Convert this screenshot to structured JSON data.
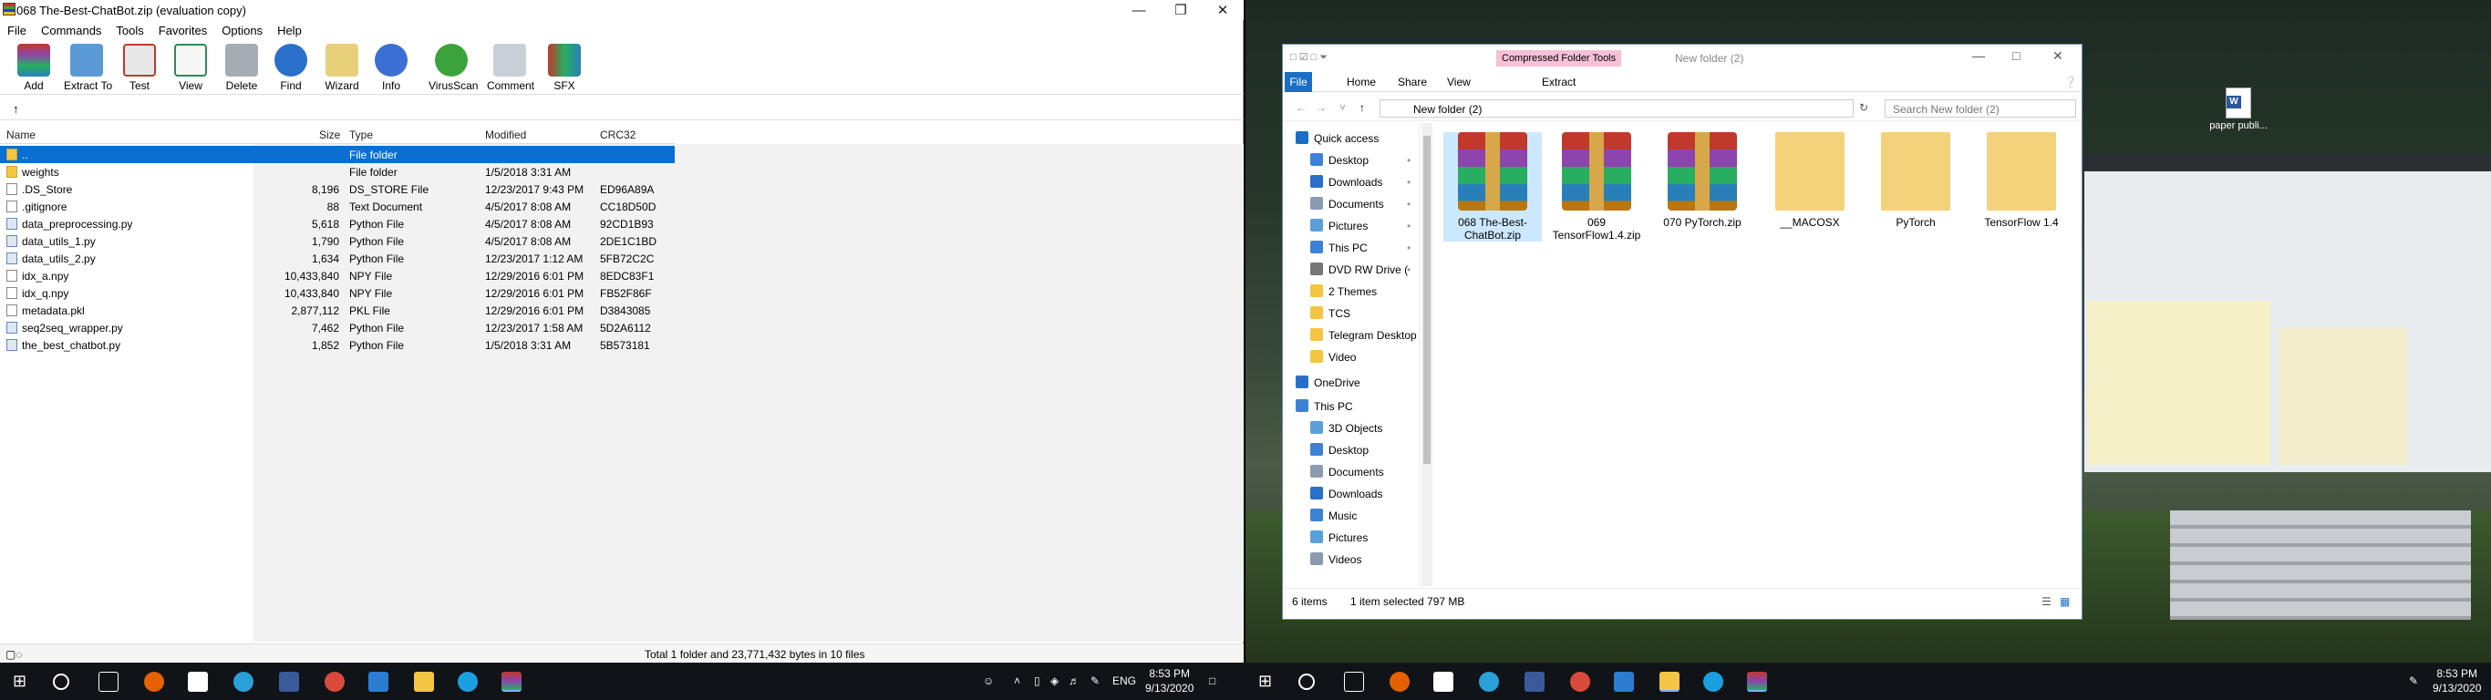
{
  "rar": {
    "title": "068 The-Best-ChatBot.zip (evaluation copy)",
    "menu": [
      "File",
      "Commands",
      "Tools",
      "Favorites",
      "Options",
      "Help"
    ],
    "toolbar": [
      {
        "label": "Add",
        "icon": "add-icon"
      },
      {
        "label": "Extract To",
        "icon": "extract-icon"
      },
      {
        "label": "Test",
        "icon": "test-icon"
      },
      {
        "label": "View",
        "icon": "view-icon"
      },
      {
        "label": "Delete",
        "icon": "delete-icon"
      },
      {
        "label": "Find",
        "icon": "find-icon"
      },
      {
        "label": "Wizard",
        "icon": "wizard-icon"
      },
      {
        "label": "Info",
        "icon": "info-icon"
      },
      {
        "label": "VirusScan",
        "icon": "virusscan-icon"
      },
      {
        "label": "Comment",
        "icon": "comment-icon"
      },
      {
        "label": "SFX",
        "icon": "sfx-icon"
      }
    ],
    "columns": [
      "Name",
      "Size",
      "Type",
      "Modified",
      "CRC32"
    ],
    "files": [
      {
        "name": "..",
        "size": "",
        "type": "File folder",
        "modified": "",
        "crc": "",
        "kind": "folder"
      },
      {
        "name": "weights",
        "size": "",
        "type": "File folder",
        "modified": "1/5/2018 3:31 AM",
        "crc": "",
        "kind": "folder"
      },
      {
        "name": ".DS_Store",
        "size": "8,196",
        "type": "DS_STORE File",
        "modified": "12/23/2017 9:43 PM",
        "crc": "ED96A89A",
        "kind": "file"
      },
      {
        "name": ".gitignore",
        "size": "88",
        "type": "Text Document",
        "modified": "4/5/2017 8:08 AM",
        "crc": "CC18D50D",
        "kind": "file"
      },
      {
        "name": "data_preprocessing.py",
        "size": "5,618",
        "type": "Python File",
        "modified": "4/5/2017 8:08 AM",
        "crc": "92CD1B93",
        "kind": "py"
      },
      {
        "name": "data_utils_1.py",
        "size": "1,790",
        "type": "Python File",
        "modified": "4/5/2017 8:08 AM",
        "crc": "2DE1C1BD",
        "kind": "py"
      },
      {
        "name": "data_utils_2.py",
        "size": "1,634",
        "type": "Python File",
        "modified": "12/23/2017 1:12 AM",
        "crc": "5FB72C2C",
        "kind": "py"
      },
      {
        "name": "idx_a.npy",
        "size": "10,433,840",
        "type": "NPY File",
        "modified": "12/29/2016 6:01 PM",
        "crc": "8EDC83F1",
        "kind": "file"
      },
      {
        "name": "idx_q.npy",
        "size": "10,433,840",
        "type": "NPY File",
        "modified": "12/29/2016 6:01 PM",
        "crc": "FB52F86F",
        "kind": "file"
      },
      {
        "name": "metadata.pkl",
        "size": "2,877,112",
        "type": "PKL File",
        "modified": "12/29/2016 6:01 PM",
        "crc": "D3843085",
        "kind": "file"
      },
      {
        "name": "seq2seq_wrapper.py",
        "size": "7,462",
        "type": "Python File",
        "modified": "12/23/2017 1:58 AM",
        "crc": "5D2A6112",
        "kind": "py"
      },
      {
        "name": "the_best_chatbot.py",
        "size": "1,852",
        "type": "Python File",
        "modified": "1/5/2018 3:31 AM",
        "crc": "5B573181",
        "kind": "py"
      }
    ],
    "status": "Total 1 folder and 23,771,432 bytes in 10 files"
  },
  "explorer": {
    "context_tab": "Compressed Folder Tools",
    "title": "New folder (2)",
    "ribbon": [
      "File",
      "Home",
      "Share",
      "View",
      "Extract"
    ],
    "address": "New folder (2)",
    "search_placeholder": "Search New folder (2)",
    "nav": [
      {
        "label": "Quick access",
        "icon": "star-icon",
        "indent": 0,
        "pinned": false
      },
      {
        "label": "Desktop",
        "icon": "desktop-icon",
        "indent": 1,
        "pinned": true
      },
      {
        "label": "Downloads",
        "icon": "downloads-icon",
        "indent": 1,
        "pinned": true
      },
      {
        "label": "Documents",
        "icon": "documents-icon",
        "indent": 1,
        "pinned": true
      },
      {
        "label": "Pictures",
        "icon": "pictures-icon",
        "indent": 1,
        "pinned": true
      },
      {
        "label": "This PC",
        "icon": "pc-icon",
        "indent": 1,
        "pinned": true
      },
      {
        "label": "DVD RW Drive (",
        "icon": "dvd-icon",
        "indent": 1,
        "pinned": true
      },
      {
        "label": "2 Themes",
        "icon": "folder-icon",
        "indent": 1,
        "pinned": false
      },
      {
        "label": "TCS",
        "icon": "folder-icon",
        "indent": 1,
        "pinned": false
      },
      {
        "label": "Telegram Desktop",
        "icon": "folder-icon",
        "indent": 1,
        "pinned": false
      },
      {
        "label": "Video",
        "icon": "folder-icon",
        "indent": 1,
        "pinned": false
      },
      {
        "label": "OneDrive",
        "icon": "onedrive-icon",
        "indent": 0,
        "pinned": false
      },
      {
        "label": "This PC",
        "icon": "pc-icon",
        "indent": 0,
        "pinned": false
      },
      {
        "label": "3D Objects",
        "icon": "3d-objects-icon",
        "indent": 1,
        "pinned": false
      },
      {
        "label": "Desktop",
        "icon": "desktop-icon",
        "indent": 1,
        "pinned": false
      },
      {
        "label": "Documents",
        "icon": "documents-icon",
        "indent": 1,
        "pinned": false
      },
      {
        "label": "Downloads",
        "icon": "downloads-icon",
        "indent": 1,
        "pinned": false
      },
      {
        "label": "Music",
        "icon": "music-icon",
        "indent": 1,
        "pinned": false
      },
      {
        "label": "Pictures",
        "icon": "pictures-icon",
        "indent": 1,
        "pinned": false
      },
      {
        "label": "Videos",
        "icon": "videos-icon",
        "indent": 1,
        "pinned": false
      }
    ],
    "items": [
      {
        "label": "068 The-Best-ChatBot.zip",
        "kind": "zip",
        "selected": true
      },
      {
        "label": "069 TensorFlow1.4.zip",
        "kind": "zip",
        "selected": false
      },
      {
        "label": "070 PyTorch.zip",
        "kind": "zip",
        "selected": false
      },
      {
        "label": "__MACOSX",
        "kind": "folder",
        "selected": false
      },
      {
        "label": "PyTorch",
        "kind": "folder",
        "selected": false
      },
      {
        "label": "TensorFlow 1.4",
        "kind": "folder",
        "selected": false
      }
    ],
    "status_count": "6 items",
    "status_selected": "1 item selected  797 MB"
  },
  "desktop": {
    "icon_label": "paper publi..."
  },
  "taskbar_left": {
    "lang": "ENG",
    "time": "8:53 PM",
    "date": "9/13/2020"
  },
  "taskbar_right": {
    "time": "8:53 PM",
    "date": "9/13/2020"
  },
  "colors": {
    "selection": "#0a6fd0",
    "accent": "#1a6fc4",
    "taskbar": "#101418"
  }
}
